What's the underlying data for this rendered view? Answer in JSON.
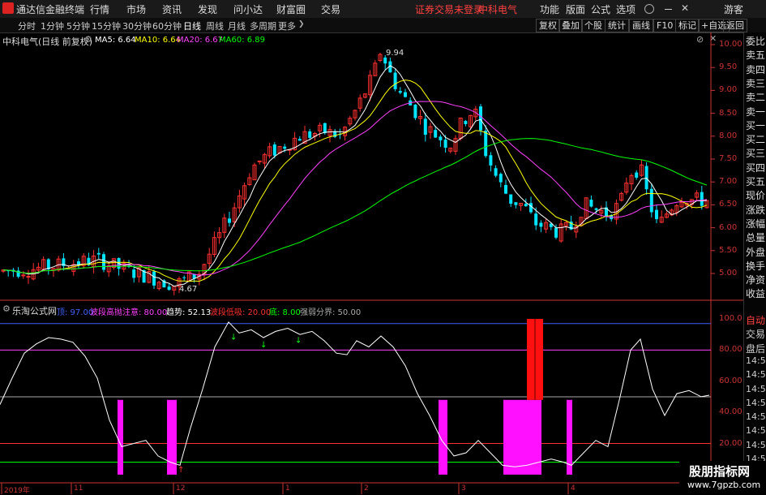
{
  "menubar": {
    "app_title": "通达信金融终端",
    "items": [
      "行情",
      "市场",
      "资讯",
      "发现",
      "问小达",
      "财富圈",
      "交易"
    ],
    "warning": "证券交易未登录",
    "stock_name": "中科电气",
    "right_items": [
      "功能",
      "版面",
      "公式",
      "选项"
    ],
    "guest": "游客"
  },
  "toolbar": {
    "periods": [
      "分时",
      "1分钟",
      "5分钟",
      "15分钟",
      "30分钟",
      "60分钟",
      "日线",
      "周线",
      "月线",
      "多周期",
      "更多"
    ],
    "active_period": "日线",
    "right_buttons": [
      "复权",
      "叠加",
      "个股",
      "统计",
      "画线",
      "F10",
      "标记",
      "+自选",
      "返回"
    ]
  },
  "main_chart": {
    "title": "中科电气(日线 前复权)",
    "ma": [
      {
        "label": "MA5: 6.64",
        "color": "#ffffff"
      },
      {
        "label": "MA10: 6.64",
        "color": "#ffff00"
      },
      {
        "label": "MA20: 6.67",
        "color": "#ff40ff"
      },
      {
        "label": "MA60: 6.89",
        "color": "#00ff00"
      }
    ],
    "y_ticks": [
      "10.00",
      "9.50",
      "9.00",
      "8.50",
      "8.00",
      "7.50",
      "7.00",
      "6.50",
      "6.00",
      "5.50",
      "5.00"
    ],
    "high_label": "9.94",
    "low_label": "4.67"
  },
  "indicator": {
    "title": "乐淘公式网",
    "legend": [
      {
        "label": "顶: 97.00",
        "color": "#4060ff"
      },
      {
        "label": "波段高抛注意: 80.00",
        "color": "#ff40ff"
      },
      {
        "label": "趋势: 52.13",
        "color": "#ffffff"
      },
      {
        "label": "波段低吸: 20.00",
        "color": "#ff3030"
      },
      {
        "label": "底: 8.00",
        "color": "#00ff00"
      },
      {
        "label": "强弱分界: 50.00",
        "color": "#aaaaaa"
      }
    ],
    "y_ticks": [
      "100.0",
      "80.00",
      "60.00",
      "40.00",
      "20.00"
    ]
  },
  "x_axis": [
    "2019年",
    "11",
    "12",
    "1",
    "2",
    "3",
    "4"
  ],
  "right_panel": {
    "top": [
      "委比",
      "卖五",
      "卖四",
      "卖三",
      "卖二",
      "卖一",
      "买一",
      "买二",
      "买三",
      "买四",
      "买五",
      "现价",
      "涨跌",
      "涨幅",
      "总量",
      "外盘",
      "换手",
      "净资",
      "收益"
    ],
    "bottom": [
      "自动",
      "交易",
      "盘后",
      "14:56",
      "14:56",
      "14:56",
      "14:56",
      "14:56",
      "14:56",
      "14:56",
      "14:56",
      "14:56",
      "14:56"
    ]
  },
  "watermark": {
    "title": "股朋指标网",
    "url": "www.7gpzb.com"
  }
}
